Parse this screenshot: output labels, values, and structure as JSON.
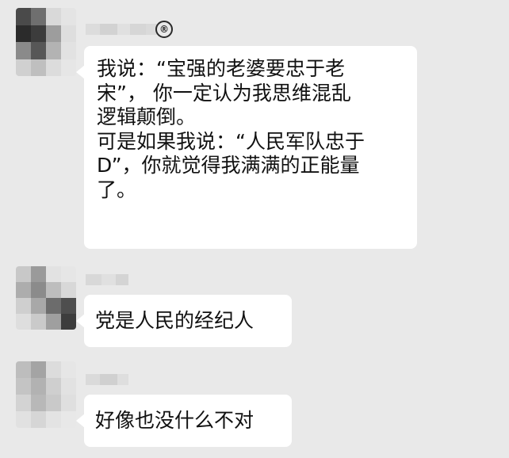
{
  "messages": [
    {
      "lines": [
        "我说：“宝强的老婆要忠于老",
        "宋”， 你一定认为我思维混乱",
        "逻辑颠倒。",
        "可是如果我说：“人民军队忠于",
        "D”，你就觉得我满满的正能量",
        "了。"
      ],
      "verified_mark": "®"
    },
    {
      "lines": [
        "党是人民的经纪人"
      ]
    },
    {
      "lines": [
        "好像也没什么不对"
      ]
    }
  ],
  "colors": {
    "background": "#e9e9e9",
    "bubble": "#ffffff",
    "text": "#111111"
  }
}
